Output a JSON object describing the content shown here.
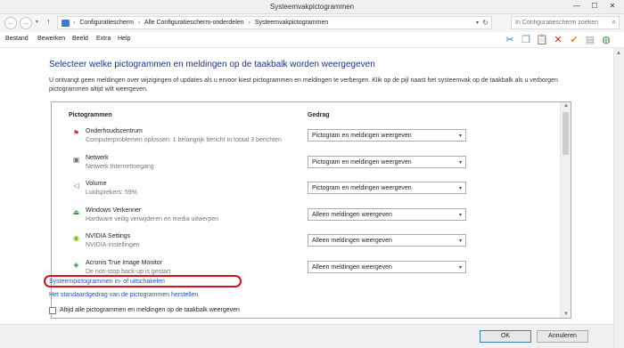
{
  "window": {
    "title": "Systeemvakpictogrammen",
    "minimize": "—",
    "maximize": "☐",
    "close": "✕"
  },
  "address": {
    "back": "←",
    "forward": "→",
    "history": "▾",
    "up": "↑",
    "crumbs": [
      "Configuratiescherm",
      "Alle Configuratiescherm-onderdelen",
      "Systeemvakpictogrammen"
    ],
    "separator": "›",
    "dropdown": "▾",
    "refresh": "↻",
    "search_placeholder": "In Configuratiescherm zoeken",
    "search_icon": "⌕"
  },
  "menu": {
    "items": [
      "Bestand",
      "Bewerken",
      "Beeld",
      "Extra",
      "Help"
    ]
  },
  "toolbar": {
    "icons": [
      {
        "name": "scissors-icon",
        "glyph": "✂",
        "color": "#2a7fc9"
      },
      {
        "name": "copy-icon",
        "glyph": "❐",
        "color": "#6b8fb8"
      },
      {
        "name": "paste-icon",
        "glyph": "📋",
        "color": "#c79a3b"
      },
      {
        "name": "delete-icon",
        "glyph": "✕",
        "color": "#d8291f"
      },
      {
        "name": "checkmark-icon",
        "glyph": "✔",
        "color": "#e08a1e"
      },
      {
        "name": "properties-icon",
        "glyph": "▤",
        "color": "#9a9a9a"
      },
      {
        "name": "globe-icon",
        "glyph": "◍",
        "color": "#3f8f3f"
      }
    ]
  },
  "main": {
    "heading": "Selecteer welke pictogrammen en meldingen op de taakbalk worden weergegeven",
    "description": "U ontvangt geen meldingen over wijzigingen of updates als u ervoor kiest pictogrammen en meldingen te verbergen. Klik op de pijl naast het systeemvak op de taakbalk als u verborgen pictogrammen altijd wilt weergeven.",
    "columns": {
      "icons": "Pictogrammen",
      "behavior": "Gedrag"
    },
    "rows": [
      {
        "icon": "flag-icon",
        "glyph": "⚑",
        "color": "#c8312b",
        "name": "Onderhoudscentrum",
        "sub": "Computerproblemen oplossen: 1 belangrijk bericht  In totaal 3 berichten",
        "behavior": "Pictogram en meldingen weergeven"
      },
      {
        "icon": "network-icon",
        "glyph": "▣",
        "color": "#6d6d6d",
        "name": "Netwerk",
        "sub": "Netwerk Internettoegang",
        "behavior": "Pictogram en meldingen weergeven"
      },
      {
        "icon": "speaker-icon",
        "glyph": "◁",
        "color": "#6d6d6d",
        "name": "Volume",
        "sub": "Luidsprekers: 59%",
        "behavior": "Pictogram en meldingen weergeven"
      },
      {
        "icon": "safely-remove-icon",
        "glyph": "⏏",
        "color": "#3c9a3c",
        "name": "Windows Verkenner",
        "sub": "Hardware veilig verwijderen en media uitwerpen",
        "behavior": "Alleen meldingen weergeven"
      },
      {
        "icon": "nvidia-icon",
        "glyph": "◉",
        "color": "#76b900",
        "name": "NVIDIA Settings",
        "sub": "NVIDIA-instellingen",
        "behavior": "Alleen meldingen weergeven"
      },
      {
        "icon": "acronis-icon",
        "glyph": "◈",
        "color": "#2f9a3b",
        "name": "Acronis True Image Monitor",
        "sub": "De non-stop back-up is gestart",
        "behavior": "Alleen meldingen weergeven"
      }
    ],
    "caret": "▾",
    "scroll_up": "▲",
    "scroll_down": "▼",
    "link_system_icons": "Systeempictogrammen in- of uitschakelen",
    "link_restore": "Het standaardgedrag van de pictogrammen herstellen",
    "always_show_label": "Altijd alle pictogrammen en meldingen op de taakbalk weergeven",
    "always_show_checked": false
  },
  "footer": {
    "ok": "OK",
    "cancel": "Annuleren"
  },
  "colors": {
    "heading": "#1e3287",
    "link": "#1a53c7",
    "highlight": "#d0121b"
  }
}
